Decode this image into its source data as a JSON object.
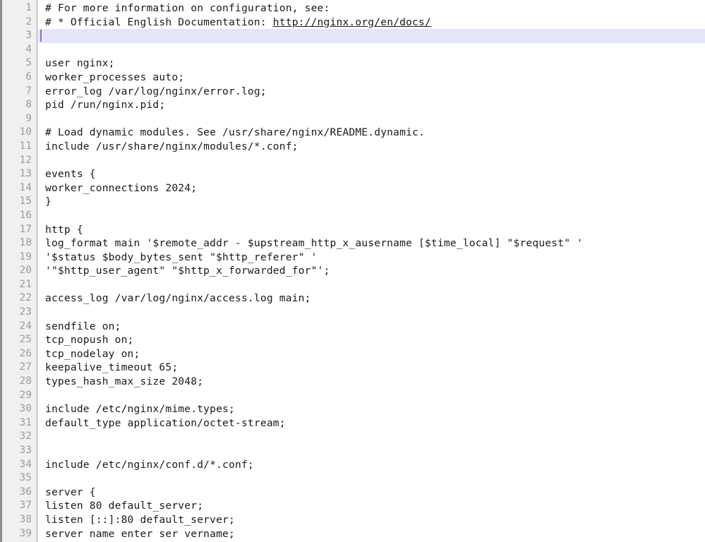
{
  "editor": {
    "colors": {
      "gutter_bg": "#f0f0f0",
      "gutter_border": "#9a9a9a",
      "content_bg": "#ffffff",
      "text": "#1a1a1a",
      "lineno": "#9b9b9b",
      "active_line_bg": "#e4e4fb",
      "caret": "#8d6ebd",
      "frame_border": "#8c8c8c"
    },
    "cursor": {
      "line": 3,
      "column": 1
    },
    "first_visible_line": 1,
    "last_visible_line": 39,
    "lines": [
      {
        "n": "1",
        "text": "# For more information on configuration, see:"
      },
      {
        "n": "2",
        "text": "# * Official English Documentation: ",
        "url": "http://nginx.org/en/docs/"
      },
      {
        "n": "3",
        "text": ""
      },
      {
        "n": "4",
        "text": ""
      },
      {
        "n": "5",
        "text": "user nginx;"
      },
      {
        "n": "6",
        "text": "worker_processes auto;"
      },
      {
        "n": "7",
        "text": "error_log /var/log/nginx/error.log;"
      },
      {
        "n": "8",
        "text": "pid /run/nginx.pid;"
      },
      {
        "n": "9",
        "text": ""
      },
      {
        "n": "10",
        "text": "# Load dynamic modules. See /usr/share/nginx/README.dynamic."
      },
      {
        "n": "11",
        "text": "include /usr/share/nginx/modules/*.conf;"
      },
      {
        "n": "12",
        "text": ""
      },
      {
        "n": "13",
        "text": "events {"
      },
      {
        "n": "14",
        "text": "worker_connections 2024;"
      },
      {
        "n": "15",
        "text": "}"
      },
      {
        "n": "16",
        "text": ""
      },
      {
        "n": "17",
        "text": "http {"
      },
      {
        "n": "18",
        "text": "log_format main '$remote_addr - $upstream_http_x_ausername [$time_local] \"$request\" '"
      },
      {
        "n": "19",
        "text": "'$status $body_bytes_sent \"$http_referer\" '"
      },
      {
        "n": "20",
        "text": "'\"$http_user_agent\" \"$http_x_forwarded_for\"';"
      },
      {
        "n": "21",
        "text": ""
      },
      {
        "n": "22",
        "text": "access_log /var/log/nginx/access.log main;"
      },
      {
        "n": "23",
        "text": ""
      },
      {
        "n": "24",
        "text": "sendfile on;"
      },
      {
        "n": "25",
        "text": "tcp_nopush on;"
      },
      {
        "n": "26",
        "text": "tcp_nodelay on;"
      },
      {
        "n": "27",
        "text": "keepalive_timeout 65;"
      },
      {
        "n": "28",
        "text": "types_hash_max_size 2048;"
      },
      {
        "n": "29",
        "text": ""
      },
      {
        "n": "30",
        "text": "include /etc/nginx/mime.types;"
      },
      {
        "n": "31",
        "text": "default_type application/octet-stream;"
      },
      {
        "n": "32",
        "text": ""
      },
      {
        "n": "33",
        "text": ""
      },
      {
        "n": "34",
        "text": "include /etc/nginx/conf.d/*.conf;"
      },
      {
        "n": "35",
        "text": ""
      },
      {
        "n": "36",
        "text": "server {"
      },
      {
        "n": "37",
        "text": "listen 80 default_server;"
      },
      {
        "n": "38",
        "text": "listen [::]:80 default_server;"
      },
      {
        "n": "39",
        "text": "server name enter ser vername;"
      }
    ]
  }
}
